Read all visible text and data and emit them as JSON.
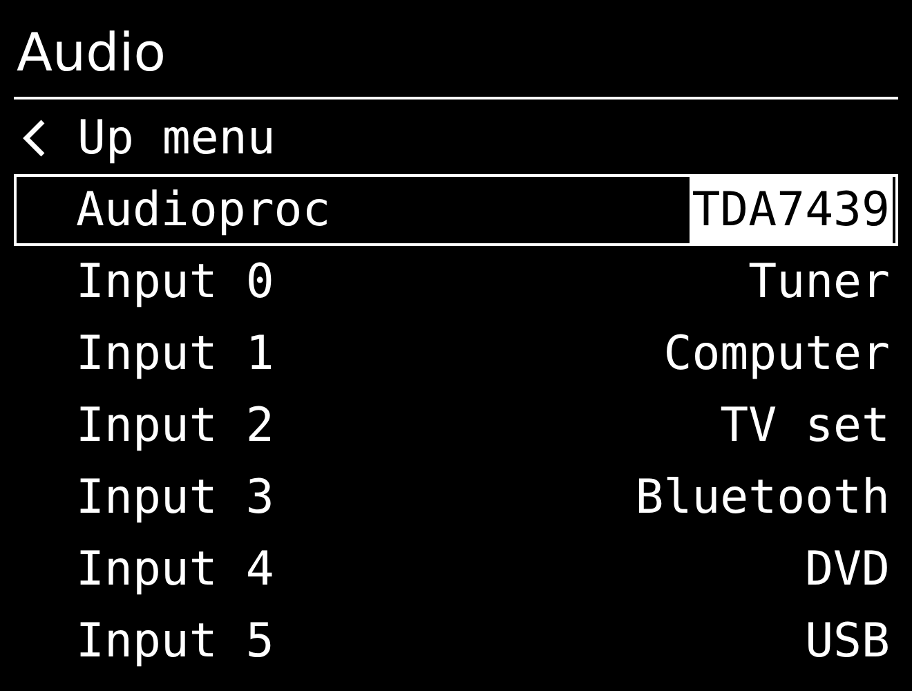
{
  "title": "Audio",
  "items": [
    {
      "kind": "back",
      "label": "Up menu",
      "selected": false
    },
    {
      "kind": "item",
      "label": "Audioproc",
      "value": "TDA7439",
      "selected": true
    },
    {
      "kind": "item",
      "label": "Input 0",
      "value": "Tuner",
      "selected": false
    },
    {
      "kind": "item",
      "label": "Input 1",
      "value": "Computer",
      "selected": false
    },
    {
      "kind": "item",
      "label": "Input 2",
      "value": "TV set",
      "selected": false
    },
    {
      "kind": "item",
      "label": "Input 3",
      "value": "Bluetooth",
      "selected": false
    },
    {
      "kind": "item",
      "label": "Input 4",
      "value": "DVD",
      "selected": false
    },
    {
      "kind": "item",
      "label": "Input 5",
      "value": "USB",
      "selected": false
    }
  ]
}
